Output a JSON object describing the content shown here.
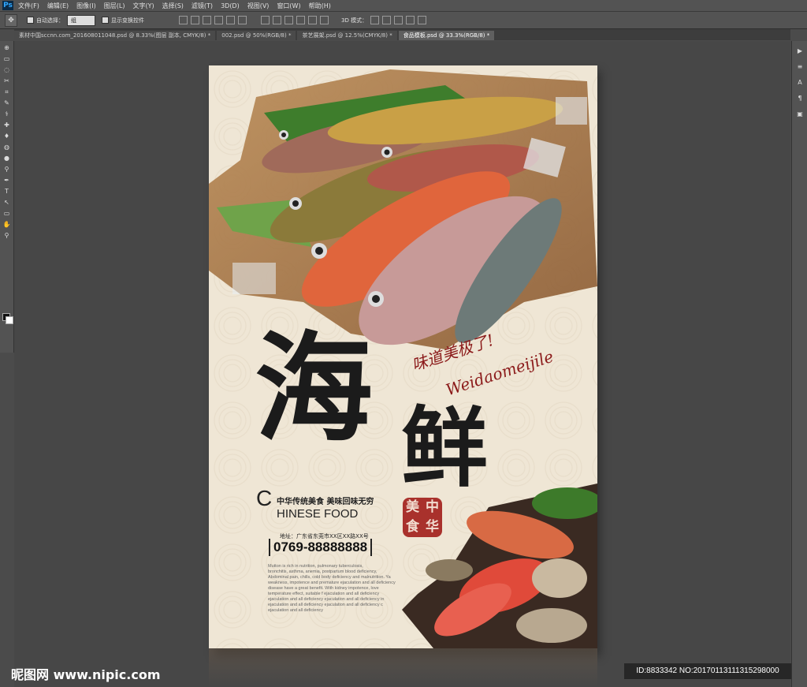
{
  "app": {
    "logo": "Ps"
  },
  "menu": [
    "文件(F)",
    "编辑(E)",
    "图像(I)",
    "图层(L)",
    "文字(Y)",
    "选择(S)",
    "滤镜(T)",
    "3D(D)",
    "视图(V)",
    "窗口(W)",
    "帮助(H)"
  ],
  "options": {
    "auto_select_label": "自动选择：",
    "auto_select_value": "组",
    "show_transform_label": "显示变换控件",
    "mode_3d_label": "3D 模式："
  },
  "tabs": [
    {
      "label": "素材中国sccnn.com_20160801104​8.psd @ 8.33%(图层 副本, CMYK/8) *",
      "active": false
    },
    {
      "label": "002.psd @ 50%(RGB/8) *",
      "active": false
    },
    {
      "label": "茶艺展架.psd @ 12.5%(CMYK/8) *",
      "active": false
    },
    {
      "label": "食品模板.psd @ 33.3%(RGB/8) *",
      "active": true
    }
  ],
  "tools": [
    "⊕",
    "▭",
    "◌",
    "✂",
    "⌗",
    "✎",
    "⚕",
    "✚",
    "♦",
    "◍",
    "●",
    "⚲",
    "✒",
    "T",
    "↖",
    "▭",
    "✋",
    "⚲"
  ],
  "right_panel_icons": [
    "▶",
    "≡",
    "A",
    "¶",
    "▣"
  ],
  "poster": {
    "headline_1": "海",
    "headline_2": "鲜",
    "script_cn": "味道美极了!",
    "script_en": "Weidaomeijile",
    "tagline_cn": "中华传统美食  美味回味无穷",
    "tagline_en_first": "C",
    "tagline_en_rest": "HINESE FOOD",
    "seal_text": [
      "美",
      "中",
      "食",
      "华"
    ],
    "address": "地址：广东省东莞市XX区XX路XX号",
    "phone": "0769-88888888",
    "body_text": [
      "Mutton is rich in nutrition, pulmonary tuberculosis,",
      "bronchitis, asthma, anemia, postpartum blood deficiency,",
      "Abdominal pain, chills, cold body deficiency and malnutrition. Ya",
      "weakness, impotence and premature ejaculation and all deficiency",
      "disease have a great benefit. With kidney impotence, love",
      "temperature effect, suitable f ejaculation and all deficiency",
      "ejaculation and all deficiency ejaculation and all deficiency in",
      "ejaculation and all deficiency ejaculation and all deficiency c",
      "ejaculation and all deficiency"
    ]
  },
  "watermark": {
    "left": "昵图网 www.nipic.com",
    "right": "ID:8833342 NO:20170113111315298000"
  }
}
